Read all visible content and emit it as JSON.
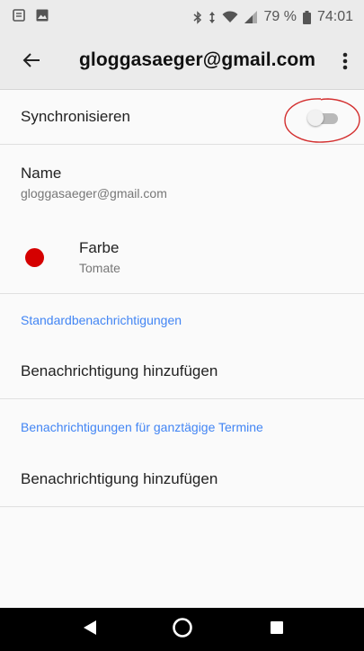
{
  "status_bar": {
    "battery_percent": "79 %",
    "time": "74:01",
    "left_icons": [
      "sim-card-icon",
      "image-icon"
    ],
    "right_icons": [
      "bluetooth-icon",
      "data-arrows-icon",
      "wifi-icon",
      "signal-icon",
      "battery-icon"
    ]
  },
  "app_bar": {
    "title": "gloggasaeger@gmail.com",
    "back_icon": "arrow-back-icon",
    "menu_icon": "more-vert-icon"
  },
  "sync": {
    "label": "Synchronisieren",
    "enabled": false
  },
  "name": {
    "label": "Name",
    "value": "gloggasaeger@gmail.com"
  },
  "color": {
    "label": "Farbe",
    "value": "Tomate",
    "swatch": "#d50000"
  },
  "sections": [
    {
      "header": "Standardbenachrichtigungen",
      "add_label": "Benachrichtigung hinzufügen"
    },
    {
      "header": "Benachrichtigungen für ganztägige Termine",
      "add_label": "Benachrichtigung hinzufügen"
    }
  ],
  "colors": {
    "accent": "#4285f4",
    "annotation": "#d32f2f"
  },
  "nav_bar": {
    "icons": [
      "back-triangle-icon",
      "home-circle-icon",
      "recents-square-icon"
    ]
  }
}
